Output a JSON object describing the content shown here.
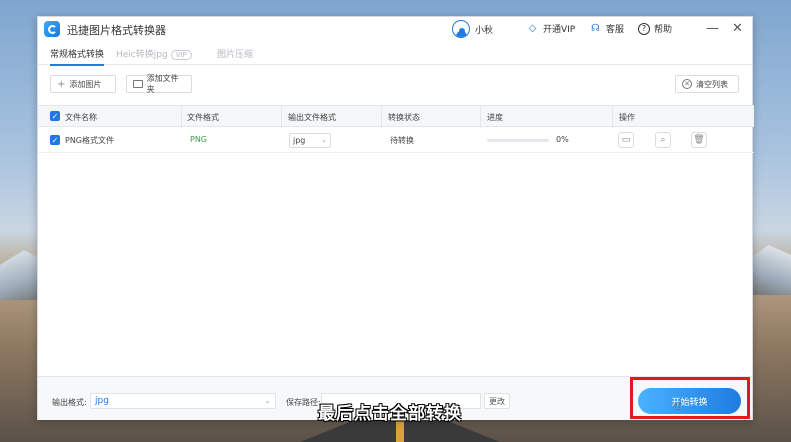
{
  "app": {
    "title": "迅捷图片格式转换器",
    "user_name": "小秋",
    "actions": {
      "vip": "开通VIP",
      "service": "客服",
      "help": "帮助"
    },
    "window_controls": {
      "minimize": "—",
      "close": "✕"
    }
  },
  "tabs": [
    {
      "label": "常规格式转换",
      "active": true
    },
    {
      "label": "Heic转换jpg",
      "badge": "VIP",
      "active": false
    },
    {
      "label": "图片压缩",
      "active": false
    }
  ],
  "toolbar": {
    "add_image": "添加图片",
    "add_folder": "添加文件夹",
    "clear_list": "清空列表"
  },
  "table": {
    "headers": [
      "文件名称",
      "文件格式",
      "输出文件格式",
      "转换状态",
      "进度",
      "操作"
    ],
    "rows": [
      {
        "name": "PNG格式文件",
        "format": "PNG",
        "output": "jpg",
        "status": "待转换",
        "progress_text": "0%",
        "progress": 0
      }
    ]
  },
  "bottom": {
    "output_format_label": "输出格式:",
    "output_format_value": "jpg",
    "save_path_label": "保存路径:",
    "change_label": "更改",
    "start_label": "开始转换"
  },
  "caption": "最后点击全部转换",
  "colors": {
    "accent": "#1f7be0",
    "highlight": "#e31a1a",
    "format_green": "#3aa148"
  }
}
